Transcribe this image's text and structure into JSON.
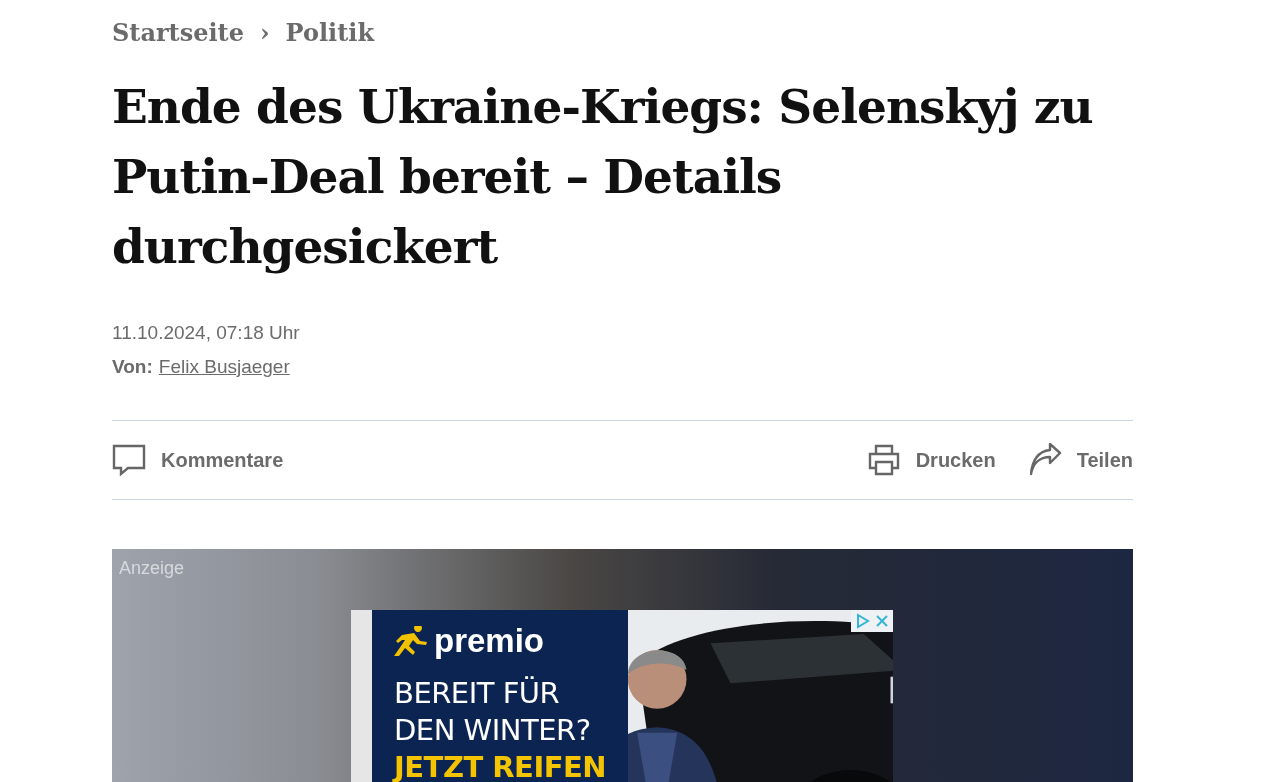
{
  "breadcrumb": [
    {
      "label": "Startseite"
    },
    {
      "label": "Politik"
    }
  ],
  "breadcrumb_separator": "›",
  "headline": "Ende des Ukraine-Kriegs: Selenskyj zu Putin-Deal bereit – Details durchgesickert",
  "date": "11.10.2024, 07:18 Uhr",
  "author": {
    "prefix": "Von:",
    "name": "Felix Busjaeger"
  },
  "actions": [
    {
      "label": "Kommentare",
      "kind": "comment"
    },
    {
      "label": "Drucken",
      "kind": "print"
    },
    {
      "label": "Teilen",
      "kind": "share"
    }
  ],
  "ad": {
    "label": "Anzeige",
    "brand": "premio",
    "headline": [
      "BEREIT FÜR",
      "DEN WINTER?"
    ],
    "highlight": "JETZT REIFEN",
    "picture": {
      "kind": "picture"
    }
  }
}
